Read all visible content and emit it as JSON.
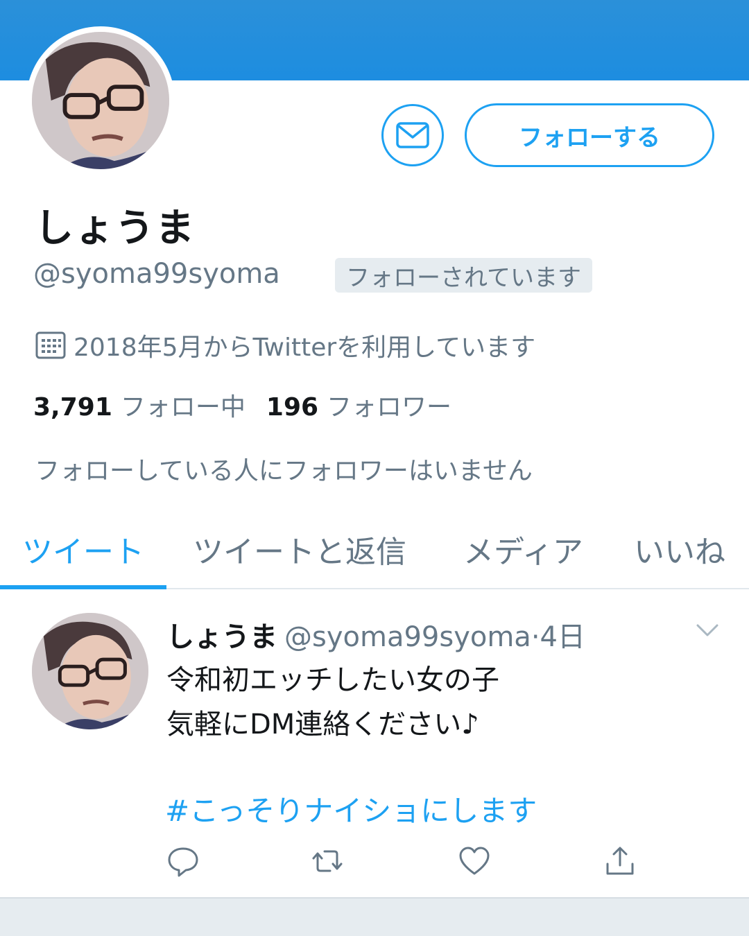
{
  "profile": {
    "display_name": "しょうま",
    "handle": "@syoma99syoma",
    "follows_you": "フォローされています",
    "joined": "2018年5月からTwitterを利用しています",
    "following_count": "3,791",
    "following_label": "フォロー中",
    "followers_count": "196",
    "followers_label": "フォロワー",
    "mutual_note": "フォローしている人にフォロワーはいません",
    "follow_button": "フォローする",
    "dm_icon": "envelope-icon",
    "calendar_icon": "calendar-icon"
  },
  "tabs": [
    {
      "label": "ツイート",
      "active": true
    },
    {
      "label": "ツイートと返信",
      "active": false
    },
    {
      "label": "メディア",
      "active": false
    },
    {
      "label": "いいね",
      "active": false
    }
  ],
  "tweet": {
    "name": "しょうま",
    "handle": "@syoma99syoma",
    "dot": "·",
    "time": "4日",
    "line1": "令和初エッチしたい女の子",
    "line2": "気軽にDM連絡ください♪",
    "hashtag": "#こっそりナイショにします",
    "actions": [
      "reply-icon",
      "retweet-icon",
      "like-icon",
      "share-icon"
    ]
  },
  "colors": {
    "accent": "#1da1f2",
    "banner": "#2b90d9",
    "secondary_text": "#657786",
    "primary_text": "#14171a",
    "divider": "#e6ecf0"
  }
}
